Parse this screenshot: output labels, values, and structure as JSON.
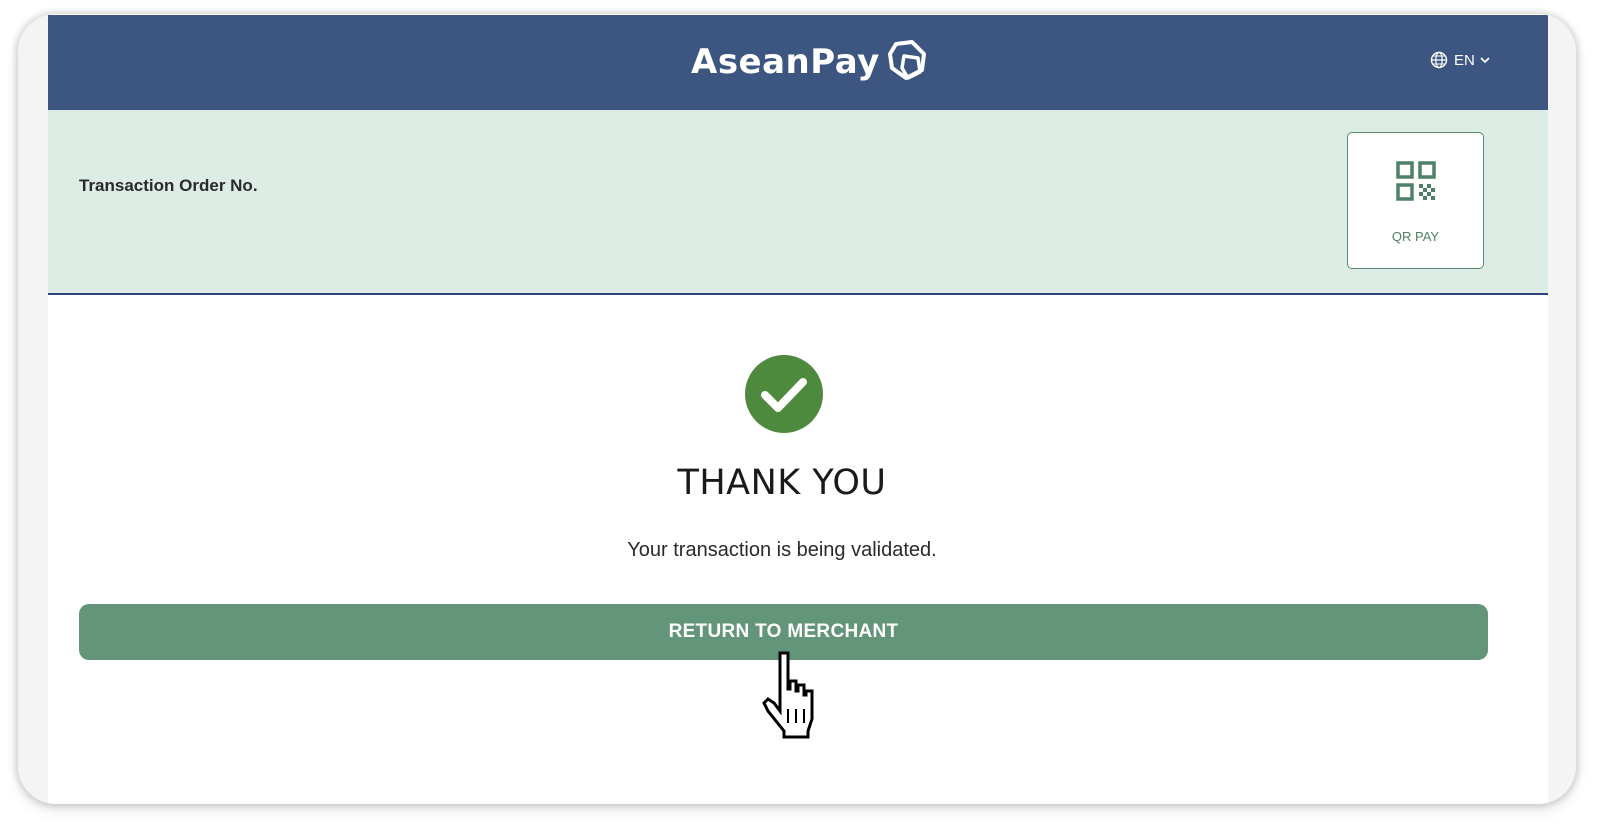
{
  "header": {
    "logo_text": "AseanPay",
    "language": "EN"
  },
  "order": {
    "label": "Transaction Order No."
  },
  "qr_pay": {
    "label": "QR PAY"
  },
  "result": {
    "title": "THANK YOU",
    "message": "Your transaction is being validated."
  },
  "actions": {
    "return_label": "RETURN TO MERCHANT"
  },
  "colors": {
    "header_bg": "#3d5581",
    "band_bg": "#deece6",
    "accent_green": "#63957b",
    "success_green": "#4e8a3e"
  },
  "icons": [
    "logo-mark-icon",
    "globe-icon",
    "chevron-down-icon",
    "qr-code-icon",
    "check-circle-icon",
    "hand-pointer-icon"
  ]
}
